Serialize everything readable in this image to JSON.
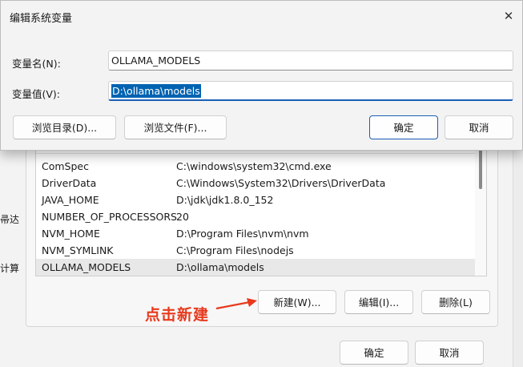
{
  "background": {
    "left_fragments": [
      "帚达",
      "计算"
    ],
    "variables": [
      {
        "name": "ComSpec",
        "value": "C:\\windows\\system32\\cmd.exe"
      },
      {
        "name": "DriverData",
        "value": "C:\\Windows\\System32\\Drivers\\DriverData"
      },
      {
        "name": "JAVA_HOME",
        "value": "D:\\jdk\\jdk1.8.0_152"
      },
      {
        "name": "NUMBER_OF_PROCESSORS",
        "value": "20"
      },
      {
        "name": "NVM_HOME",
        "value": "D:\\Program Files\\nvm\\nvm"
      },
      {
        "name": "NVM_SYMLINK",
        "value": "C:\\Program Files\\nodejs"
      },
      {
        "name": "OLLAMA_MODELS",
        "value": "D:\\ollama\\models"
      }
    ],
    "buttons": {
      "new": "新建(W)...",
      "edit": "编辑(I)...",
      "delete": "删除(L)",
      "ok": "确定",
      "cancel": "取消"
    },
    "annotation": "点击新建"
  },
  "dialog": {
    "title": "编辑系统变量",
    "close_glyph": "✕",
    "name_label": "变量名(N):",
    "name_value": "OLLAMA_MODELS",
    "value_label": "变量值(V):",
    "value_value": "D:\\ollama\\models",
    "browse_dir": "浏览目录(D)...",
    "browse_file": "浏览文件(F)...",
    "ok": "确定",
    "cancel": "取消"
  },
  "colors": {
    "accent": "#1a5fb4",
    "selection": "#0063b1",
    "annotation": "#e8391d"
  }
}
